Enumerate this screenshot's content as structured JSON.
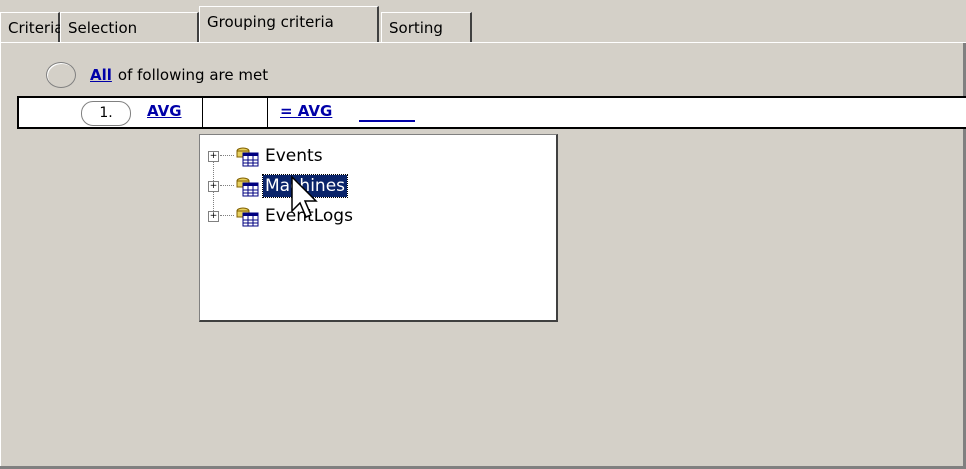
{
  "tabs": [
    {
      "label": "Criteria"
    },
    {
      "label": "Selection"
    },
    {
      "label": "Grouping criteria"
    },
    {
      "label": "Sorting"
    }
  ],
  "active_tab": "Grouping criteria",
  "all_row": {
    "link": "All",
    "text": "of following are met"
  },
  "condition": {
    "number": "1.",
    "left_func": "AVG",
    "operator": "= AVG",
    "value": ""
  },
  "tree": {
    "items": [
      {
        "label": "Events",
        "icon": "table-icon"
      },
      {
        "label": "Machines",
        "icon": "table-icon",
        "selected": true
      },
      {
        "label": "EventLogs",
        "icon": "table-icon"
      }
    ]
  },
  "colors": {
    "background": "#d4d0c8",
    "link": "#0000a8",
    "selection": "#0a246a"
  }
}
